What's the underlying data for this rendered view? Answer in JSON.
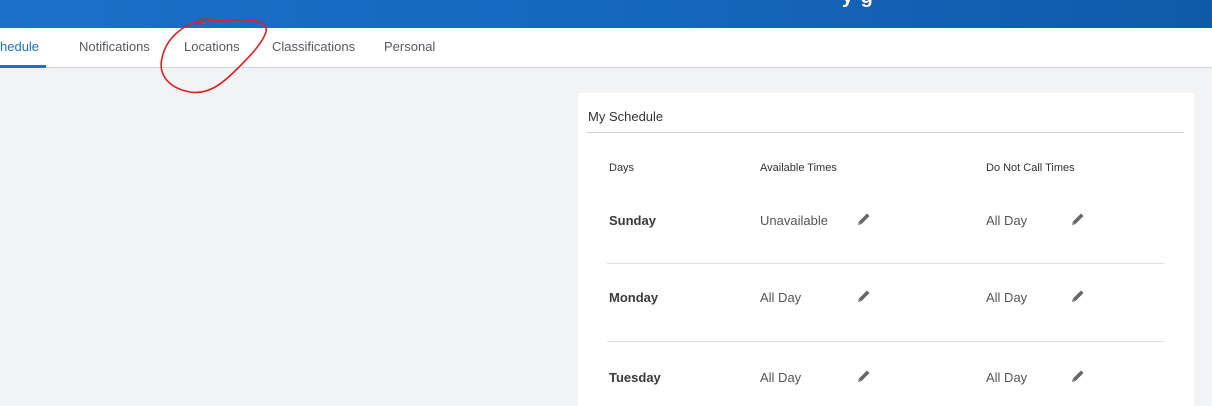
{
  "header": {
    "title_fragment": "y  g"
  },
  "tabs": [
    {
      "label": "hedule",
      "active": true
    },
    {
      "label": "Notifications",
      "active": false
    },
    {
      "label": "Locations",
      "active": false
    },
    {
      "label": "Classifications",
      "active": false
    },
    {
      "label": "Personal",
      "active": false
    }
  ],
  "schedule": {
    "title": "My Schedule",
    "columns": {
      "days": "Days",
      "available": "Available Times",
      "do_not_call": "Do Not Call Times"
    },
    "rows": [
      {
        "day": "Sunday",
        "available": "Unavailable",
        "do_not_call": "All Day"
      },
      {
        "day": "Monday",
        "available": "All Day",
        "do_not_call": "All Day"
      },
      {
        "day": "Tuesday",
        "available": "All Day",
        "do_not_call": "All Day"
      }
    ]
  },
  "icons": {
    "edit": "pencil-icon"
  },
  "colors": {
    "accent": "#1a73c8",
    "header_bar": "#1566bd",
    "annotation": "#e02020"
  }
}
